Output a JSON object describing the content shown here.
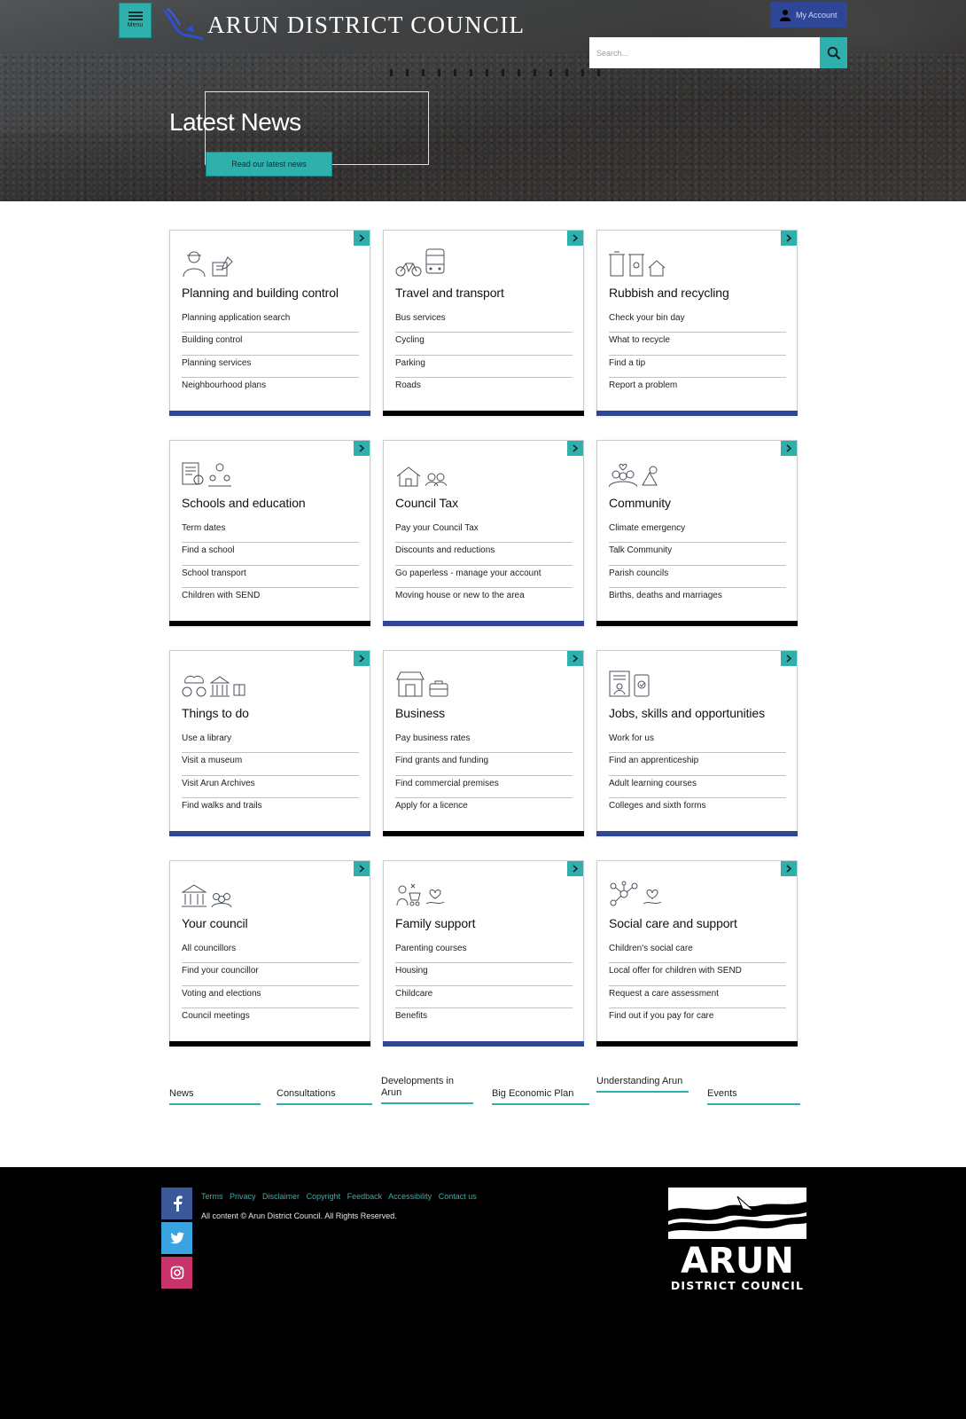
{
  "header": {
    "menu_label": "Menu",
    "site_title": "ARUN DISTRICT COUNCIL",
    "account_label": "My Account",
    "search_placeholder": "Search..."
  },
  "hero": {
    "title": "Latest News",
    "button_label": "Read our latest news"
  },
  "cards": [
    {
      "title": "Planning and building control",
      "links": [
        "Planning application search",
        "Building control",
        "Planning services",
        "Neighbourhood plans"
      ],
      "bar": "blue"
    },
    {
      "title": "Travel and transport",
      "links": [
        "Bus services",
        "Cycling",
        "Parking",
        "Roads"
      ],
      "bar": "black"
    },
    {
      "title": "Rubbish and recycling",
      "links": [
        "Check your bin day",
        "What to recycle",
        "Find a tip",
        "Report a problem"
      ],
      "bar": "blue"
    },
    {
      "title": "Schools and education",
      "links": [
        "Term dates",
        "Find a school",
        "School transport",
        "Children with SEND"
      ],
      "bar": "black"
    },
    {
      "title": "Council Tax",
      "links": [
        "Pay your Council Tax",
        "Discounts and reductions",
        "Go paperless - manage your account",
        "Moving house or new to the area"
      ],
      "bar": "blue"
    },
    {
      "title": "Community",
      "links": [
        "Climate emergency",
        "Talk Community",
        "Parish councils",
        "Births, deaths and marriages"
      ],
      "bar": "black"
    },
    {
      "title": "Things to do",
      "links": [
        "Use a library",
        "Visit a museum",
        "Visit Arun Archives",
        "Find walks and trails"
      ],
      "bar": "blue"
    },
    {
      "title": "Business",
      "links": [
        "Pay business rates",
        "Find grants and funding",
        "Find commercial premises",
        "Apply for a licence"
      ],
      "bar": "black"
    },
    {
      "title": "Jobs, skills and opportunities",
      "links": [
        "Work for us",
        "Find an apprenticeship",
        "Adult learning courses",
        "Colleges and sixth forms"
      ],
      "bar": "blue"
    },
    {
      "title": "Your council",
      "links": [
        "All councillors",
        "Find your councillor",
        "Voting and elections",
        "Council meetings"
      ],
      "bar": "black"
    },
    {
      "title": "Family support",
      "links": [
        "Parenting courses",
        "Housing",
        "Childcare",
        "Benefits"
      ],
      "bar": "blue"
    },
    {
      "title": "Social care and support",
      "links": [
        "Children's social care",
        "Local offer for children with SEND",
        "Request a care assessment",
        "Find out if you pay for care"
      ],
      "bar": "black"
    }
  ],
  "quick_links": [
    "News",
    "Consultations",
    "Developments in Arun",
    "Big Economic Plan",
    "Understanding Arun",
    "Events"
  ],
  "footer": {
    "links": [
      "Terms",
      "Privacy",
      "Disclaimer",
      "Copyright",
      "Feedback",
      "Accessibility",
      "Contact us"
    ],
    "copyright": "All content © Arun District Council. All Rights Reserved.",
    "logo_text": "ARUN",
    "logo_subtext": "DISTRICT COUNCIL"
  },
  "colors": {
    "teal": "#2fb0ad",
    "blue": "#2f4596",
    "black": "#000000"
  }
}
